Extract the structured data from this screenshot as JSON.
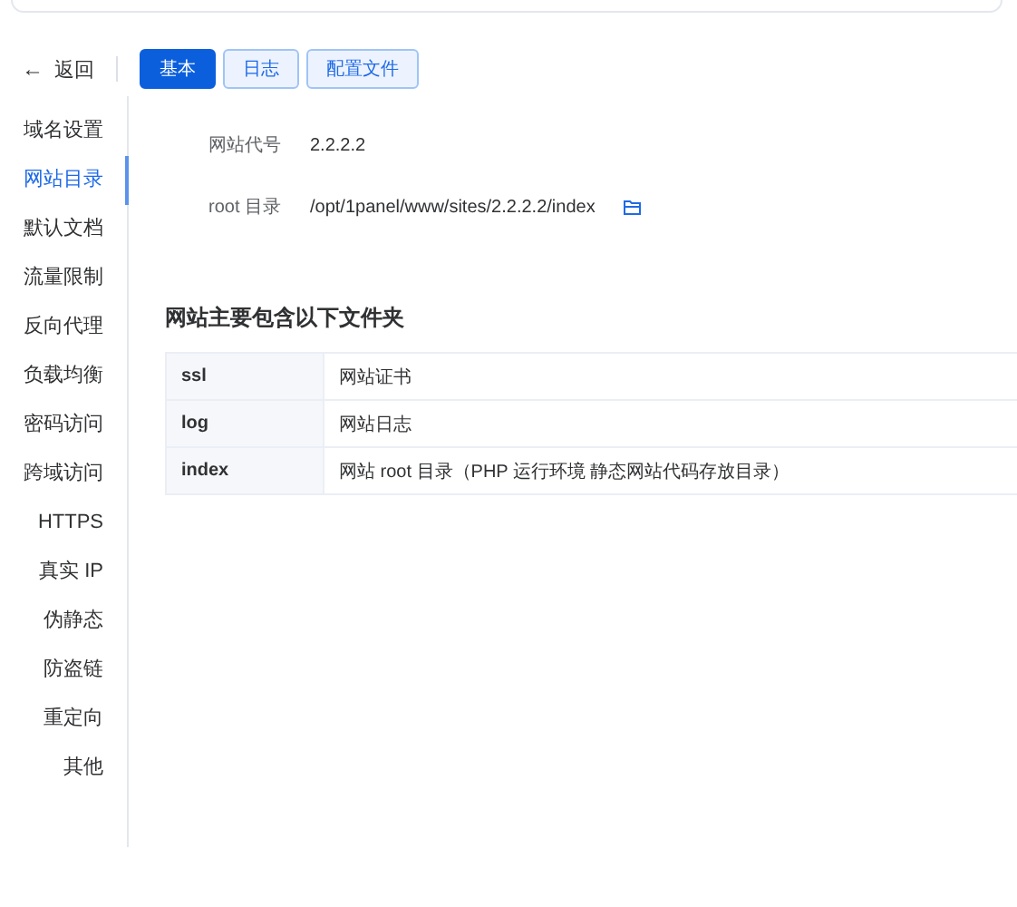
{
  "header": {
    "back": {
      "icon": "←",
      "label": "返回"
    },
    "tabs": [
      {
        "label": "基本",
        "selected": true
      },
      {
        "label": "日志",
        "selected": false
      },
      {
        "label": "配置文件",
        "selected": false
      }
    ]
  },
  "sidebar": {
    "items": [
      {
        "label": "域名设置",
        "selected": false
      },
      {
        "label": "网站目录",
        "selected": true
      },
      {
        "label": "默认文档",
        "selected": false
      },
      {
        "label": "流量限制",
        "selected": false
      },
      {
        "label": "反向代理",
        "selected": false
      },
      {
        "label": "负载均衡",
        "selected": false
      },
      {
        "label": "密码访问",
        "selected": false
      },
      {
        "label": "跨域访问",
        "selected": false
      },
      {
        "label": "HTTPS",
        "selected": false
      },
      {
        "label": "真实 IP",
        "selected": false
      },
      {
        "label": "伪静态",
        "selected": false
      },
      {
        "label": "防盗链",
        "selected": false
      },
      {
        "label": "重定向",
        "selected": false
      },
      {
        "label": "其他",
        "selected": false
      }
    ]
  },
  "fields": [
    {
      "label": "网站代号",
      "value": "2.2.2.2",
      "kind": "text"
    },
    {
      "label": "root 目录",
      "value": "/opt/1panel/www/sites/2.2.2.2/index",
      "kind": "path"
    }
  ],
  "folders": {
    "title": "网站主要包含以下文件夹",
    "rows": [
      {
        "name": "ssl",
        "description": "网站证书"
      },
      {
        "name": "log",
        "description": "网站日志"
      },
      {
        "name": "index",
        "description": "网站 root 目录（PHP 运行环境 静态网站代码存放目录）"
      }
    ]
  }
}
